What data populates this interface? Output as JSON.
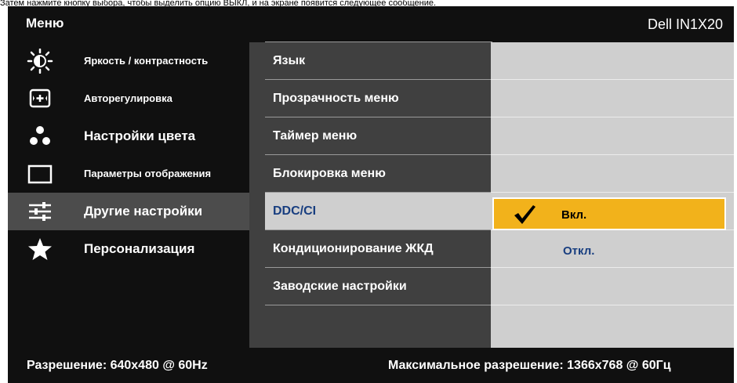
{
  "caption": "Затем нажмите кнопку выбора, чтобы выделить опцию ВЫКЛ, и на экране появится следующее сообщение.",
  "header": {
    "menu_title": "Меню",
    "model": "Dell IN1X20"
  },
  "sidebar": {
    "items": [
      {
        "label": "Яркость / контрастность",
        "icon": "brightness-icon",
        "active": false
      },
      {
        "label": "Авторегулировка",
        "icon": "auto-adjust-icon",
        "active": false
      },
      {
        "label": "Настройки цвета",
        "icon": "color-settings-icon",
        "active": false
      },
      {
        "label": "Параметры отображения",
        "icon": "display-settings-icon",
        "active": false
      },
      {
        "label": "Другие настройки",
        "icon": "other-settings-icon",
        "active": true
      },
      {
        "label": "Персонализация",
        "icon": "star-icon",
        "active": false
      }
    ]
  },
  "submenu": {
    "items": [
      {
        "label": "Язык",
        "active": false
      },
      {
        "label": "Прозрачность меню",
        "active": false
      },
      {
        "label": "Таймер меню",
        "active": false
      },
      {
        "label": "Блокировка меню",
        "active": false
      },
      {
        "label": "DDC/CI",
        "active": true
      },
      {
        "label": "Кондиционирование ЖКД",
        "active": false
      },
      {
        "label": "Заводские настройки",
        "active": false
      }
    ]
  },
  "options": {
    "items": [
      {
        "label": "Вкл.",
        "selected": true
      },
      {
        "label": "Откл.",
        "selected": false
      }
    ],
    "check_icon": "checkmark-icon"
  },
  "footer": {
    "resolution": "Разрешение:  640x480 @ 60Hz",
    "max_resolution": "Максимальное разрешение: 1366x768 @ 60Гц"
  },
  "colors": {
    "highlight": "#f2b21b",
    "selected_text": "#183e80",
    "panel_dark": "#101010",
    "panel_mid": "#404040",
    "panel_light": "#cfcfcf"
  }
}
